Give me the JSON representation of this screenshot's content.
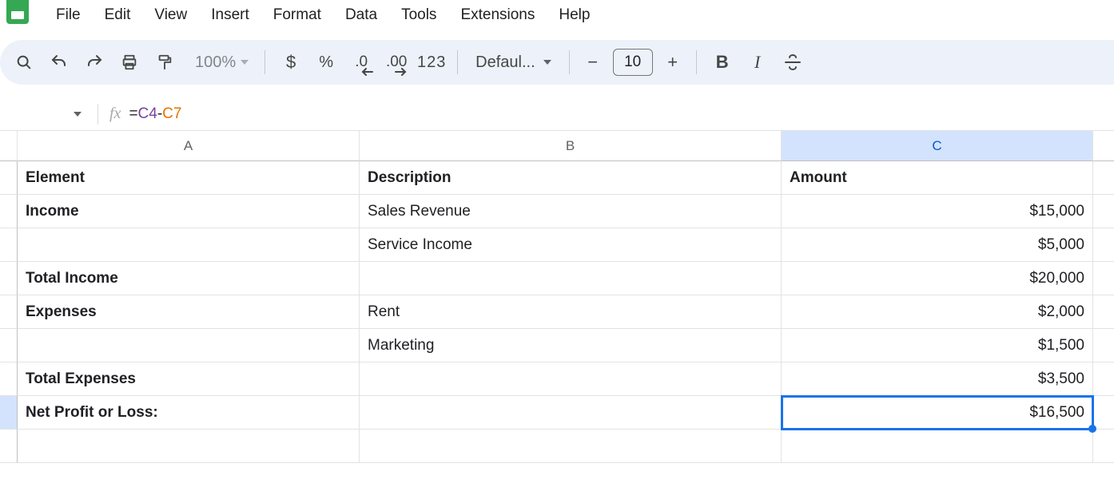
{
  "menu": {
    "items": [
      "File",
      "Edit",
      "View",
      "Insert",
      "Format",
      "Data",
      "Tools",
      "Extensions",
      "Help"
    ]
  },
  "toolbar": {
    "zoom": "100%",
    "currency_label": "$",
    "percent_label": "%",
    "dec_less": ".0",
    "dec_more": ".00",
    "numfmt": "123",
    "font_name": "Defaul...",
    "font_size": "10",
    "minus": "−",
    "plus": "+",
    "bold": "B",
    "italic": "I"
  },
  "formula_bar": {
    "fx_label": "fx",
    "eq": "=",
    "ref1": "C4",
    "minus": "-",
    "ref2": "C7"
  },
  "columns": [
    "A",
    "B",
    "C"
  ],
  "selected_column_index": 2,
  "rows": [
    {
      "a": "Element",
      "b": "Description",
      "c": "Amount",
      "bold": true,
      "c_align": "left"
    },
    {
      "a": "Income",
      "b": "Sales Revenue",
      "c": "$15,000",
      "a_bold": true
    },
    {
      "a": "",
      "b": "Service Income",
      "c": "$5,000"
    },
    {
      "a": "Total Income",
      "b": "",
      "c": "$20,000",
      "a_bold": true
    },
    {
      "a": "Expenses",
      "b": "Rent",
      "c": "$2,000",
      "a_bold": true
    },
    {
      "a": "",
      "b": "Marketing",
      "c": "$1,500"
    },
    {
      "a": "Total Expenses",
      "b": "",
      "c": "$3,500",
      "a_bold": true
    },
    {
      "a": "Net Profit or Loss:",
      "b": "",
      "c": "$16,500",
      "a_bold": true,
      "active_c": true
    },
    {
      "a": "",
      "b": "",
      "c": ""
    }
  ]
}
